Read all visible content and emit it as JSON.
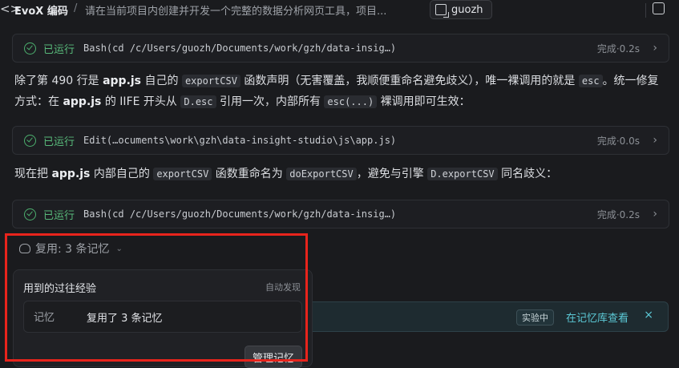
{
  "header": {
    "app_title": "EvoX 编码",
    "separator": "/",
    "task_title": "请在当前项目内创建并开发一个完整的数据分析网页工具，项目...",
    "user_name": "guozh"
  },
  "tool_calls": [
    {
      "status": "已运行",
      "command": "Bash(cd /c/Users/guozh/Documents/work/gzh/data-insig…)",
      "duration": "完成·0.2s"
    },
    {
      "status": "已运行",
      "command": "Edit(…ocuments\\work\\gzh\\data-insight-studio\\js\\app.js)",
      "duration": "完成·0.0s"
    },
    {
      "status": "已运行",
      "command": "Bash(cd /c/Users/guozh/Documents/work/gzh/data-insig…)",
      "duration": "完成·0.2s"
    }
  ],
  "messages": {
    "m1": {
      "t1": "除了第 490 行是 ",
      "b1": "app.js",
      "t2": " 自己的 ",
      "c1": "exportCSV",
      "t3": " 函数声明（无害覆盖，我顺便重命名避免歧义），唯一裸调用的就是 ",
      "c2": "esc",
      "t4": "。统一修复方式：在 ",
      "b2": "app.js",
      "t5": " 的 IIFE 开头从 ",
      "c3": "D.esc",
      "t6": " 引用一次，内部所有 ",
      "c4": "esc(...)",
      "t7": " 裸调用即可生效："
    },
    "m2": {
      "t1": "现在把 ",
      "b1": "app.js",
      "t2": " 内部自己的 ",
      "c1": "exportCSV",
      "t3": " 函数重命名为 ",
      "c2": "doExportCSV",
      "t4": "，避免与引擎 ",
      "c3": "D.exportCSV",
      "t5": " 同名歧义："
    }
  },
  "memory": {
    "toggle_label": "复用: 3 条记忆",
    "panel_title": "用到的过往经验",
    "auto_label": "自动发现",
    "row_key": "记忆",
    "row_value": "复用了 3 条记忆",
    "manage_button": "管理记忆"
  },
  "banner": {
    "tag": "实验中",
    "link": "在记忆库查看",
    "close": "×"
  },
  "colors": {
    "background": "#1a1b1e",
    "success": "#58b97a",
    "link": "#5cc9d6",
    "highlight": "#e8241c"
  }
}
